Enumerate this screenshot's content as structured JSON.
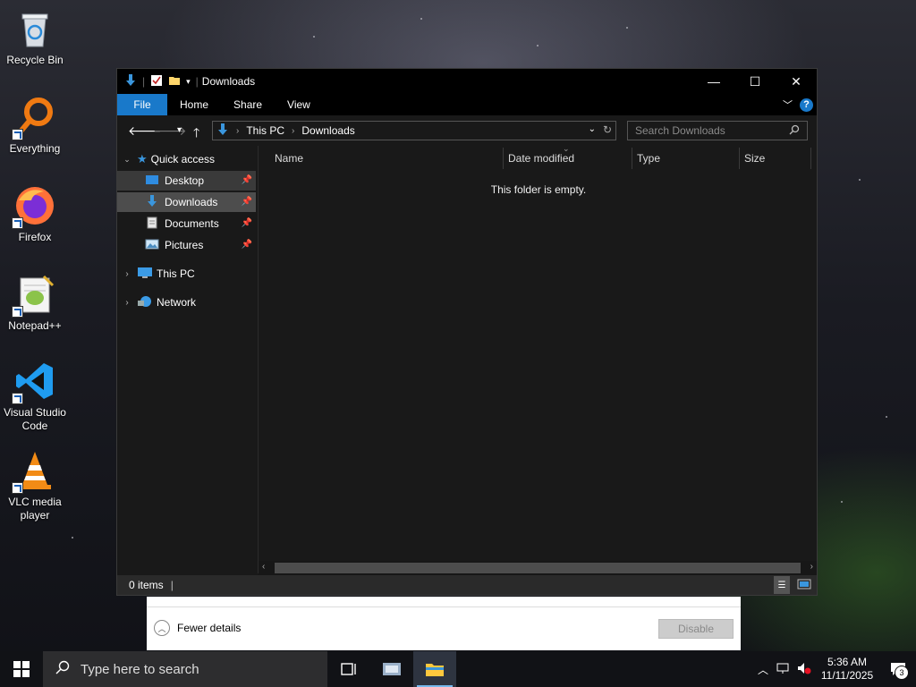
{
  "desktop": {
    "icons": [
      {
        "label": "Recycle Bin"
      },
      {
        "label": "Everything"
      },
      {
        "label": "Firefox"
      },
      {
        "label": "Notepad++"
      },
      {
        "label": "Visual Studio Code"
      },
      {
        "label": "VLC media player"
      }
    ]
  },
  "explorer": {
    "title": "Downloads",
    "window_controls": {
      "minimize": "—",
      "maximize": "☐",
      "close": "✕"
    },
    "ribbon_tabs": [
      "File",
      "Home",
      "Share",
      "View"
    ],
    "breadcrumb": [
      "This PC",
      "Downloads"
    ],
    "search_placeholder": "Search Downloads",
    "nav": {
      "quick_access": "Quick access",
      "items": [
        "Desktop",
        "Downloads",
        "Documents",
        "Pictures"
      ],
      "this_pc": "This PC",
      "network": "Network"
    },
    "columns": [
      "Name",
      "Date modified",
      "Type",
      "Size"
    ],
    "empty_message": "This folder is empty.",
    "status": "0 items"
  },
  "dialog": {
    "fewer_details": "Fewer details",
    "disable_label": "Disable"
  },
  "taskbar": {
    "search_placeholder": "Type here to search",
    "time": "5:36 AM",
    "date": "11/11/2025",
    "notification_count": "3"
  },
  "colors": {
    "accent": "#1979ca",
    "selected": "#4d4d4d",
    "window_bg": "#191919"
  }
}
